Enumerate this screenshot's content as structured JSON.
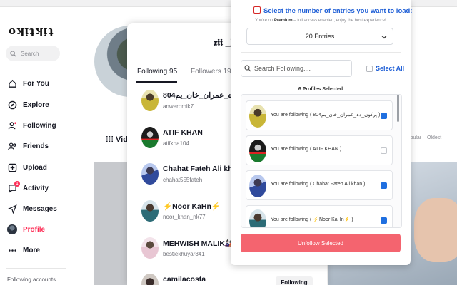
{
  "sidebar": {
    "logo": "oʞᴉʇʞᴉʇ",
    "search_placeholder": "Search",
    "items": [
      {
        "label": "For You",
        "icon": "home-icon"
      },
      {
        "label": "Explore",
        "icon": "compass-icon"
      },
      {
        "label": "Following",
        "icon": "following-icon"
      },
      {
        "label": "Friends",
        "icon": "friends-icon"
      },
      {
        "label": "Upload",
        "icon": "upload-icon"
      },
      {
        "label": "Activity",
        "icon": "activity-icon",
        "badge": "1"
      },
      {
        "label": "Messages",
        "icon": "messages-icon"
      },
      {
        "label": "Profile",
        "icon": "profile-avatar",
        "active": true
      },
      {
        "label": "More",
        "icon": "more-icon"
      }
    ],
    "following_accounts_label": "Following accounts",
    "accent_color": "#fe2c55"
  },
  "background": {
    "videos_tab": "Videos",
    "sort_popular": "Popular",
    "sort_oldest": "Oldest"
  },
  "follow_modal": {
    "title": "𝖝𝖎𝖎 _𝐤𝐡",
    "tab_following": "Following 95",
    "tab_followers": "Followers 19",
    "rows": [
      {
        "name": "پرکون_دہ_عمران_خان_یم804",
        "handle": "anwerpmik7"
      },
      {
        "name": "ATIF KHAN",
        "handle": "atifkha104"
      },
      {
        "name": "Chahat Fateh Ali khan",
        "handle": "chahat555fateh"
      },
      {
        "name": "⚡Noor KaHn⚡",
        "handle": "noor_khan_nk77"
      },
      {
        "name": "MEHWISH MALIK🎎🍃",
        "handle": "bestiekhuyar341"
      },
      {
        "name": "camilacosta",
        "handle": ""
      }
    ],
    "following_button": "Following"
  },
  "extension": {
    "title": "Select the number of entries you want to load:",
    "subtitle_prefix": "You're on",
    "subtitle_plan": "Premium",
    "subtitle_suffix": "– full access enabled, enjoy the best experience!",
    "entries_select": "20 Entries",
    "search_placeholder": "Search Following....",
    "select_all": "Select All",
    "selected_count": "6 Profiles Selected",
    "cards": [
      {
        "text": "You are following ( پرکون_دہ_عمران_خان_یم804 )",
        "checked": true
      },
      {
        "text": "You are following ( ATIF KHAN )",
        "checked": false
      },
      {
        "text": "You are following ( Chahat Fateh Ali khan )",
        "checked": true
      },
      {
        "text": "You are following ( ⚡Noor KaHn⚡ )",
        "checked": true
      }
    ],
    "unfollow_button": "Unfollow Selected",
    "primary_color": "#1f5fd6",
    "button_color": "#f4646f"
  }
}
